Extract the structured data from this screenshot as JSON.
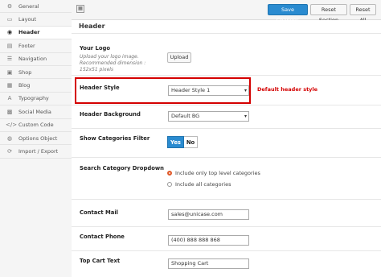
{
  "sidebar": {
    "items": [
      {
        "label": "General",
        "icon": "gear-icon",
        "glyph": "⚙",
        "active": false
      },
      {
        "label": "Layout",
        "icon": "layout-icon",
        "glyph": "▭",
        "active": false
      },
      {
        "label": "Header",
        "icon": "header-icon",
        "glyph": "◉",
        "active": true
      },
      {
        "label": "Footer",
        "icon": "footer-icon",
        "glyph": "▤",
        "active": false
      },
      {
        "label": "Navigation",
        "icon": "navigation-icon",
        "glyph": "☰",
        "active": false
      },
      {
        "label": "Shop",
        "icon": "shop-icon",
        "glyph": "▣",
        "active": false
      },
      {
        "label": "Blog",
        "icon": "blog-icon",
        "glyph": "▦",
        "active": false
      },
      {
        "label": "Typography",
        "icon": "typography-icon",
        "glyph": "A",
        "active": false
      },
      {
        "label": "Social Media",
        "icon": "social-media-icon",
        "glyph": "▩",
        "active": false
      },
      {
        "label": "Custom Code",
        "icon": "code-icon",
        "glyph": "</>",
        "active": false
      },
      {
        "label": "Options Object",
        "icon": "options-object-icon",
        "glyph": "◍",
        "active": false
      },
      {
        "label": "Import / Export",
        "icon": "import-export-icon",
        "glyph": "⟳",
        "active": false
      }
    ]
  },
  "toolbar": {
    "save_label": "Save Changes",
    "reset_section_label": "Reset Section",
    "reset_all_label": "Reset All",
    "primary_color": "#2a8bd0"
  },
  "main": {
    "title": "Header",
    "logo": {
      "label": "Your Logo",
      "description": "Upload your logo image. Recommended dimension : 152x51 pixels",
      "upload_label": "Upload"
    },
    "header_style": {
      "label": "Header Style",
      "value": "Header Style 1",
      "annotation": "Default header style",
      "highlight_color": "#d40000"
    },
    "header_background": {
      "label": "Header Background",
      "value": "Default BG"
    },
    "categories_filter": {
      "label": "Show Categories Filter",
      "yes_label": "Yes",
      "no_label": "No",
      "selected": "Yes"
    },
    "search_category": {
      "label": "Search Category Dropdown",
      "options": [
        {
          "label": "Include only top level categories",
          "checked": true
        },
        {
          "label": "Include all categories",
          "checked": false
        }
      ]
    },
    "contact_mail": {
      "label": "Contact Mail",
      "value": "sales@unicase.com"
    },
    "contact_phone": {
      "label": "Contact Phone",
      "value": "(400) 888 888 868"
    },
    "top_cart_text": {
      "label": "Top Cart Text",
      "value": "Shopping Cart"
    }
  }
}
